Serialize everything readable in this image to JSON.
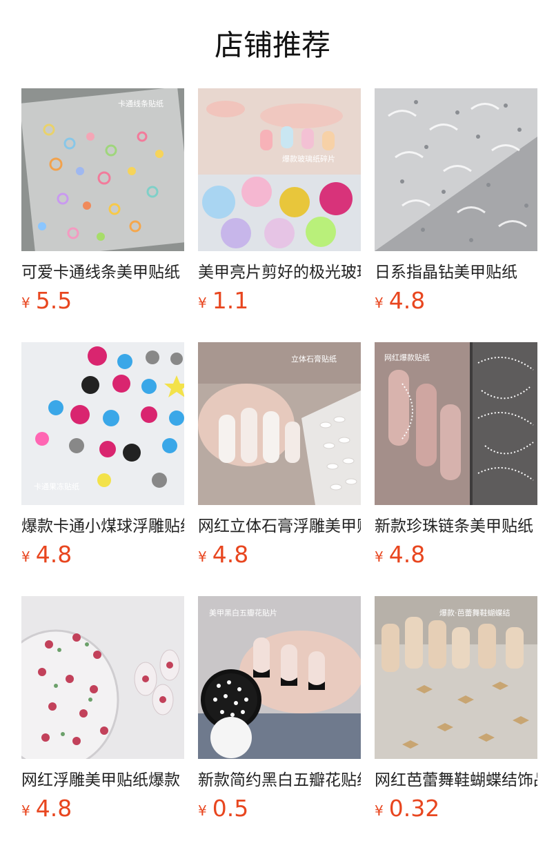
{
  "page": {
    "title": "店铺推荐"
  },
  "products": [
    {
      "name": "可爱卡通线条美甲贴纸",
      "currency": "¥",
      "price": "5.5",
      "image_label": "卡通线条贴纸",
      "image_icon": "cartoon-line-sticker-image"
    },
    {
      "name": "美甲亮片剪好的极光玻璃纸",
      "currency": "¥",
      "price": "1.1",
      "image_label": "爆款玻璃纸碎片",
      "image_icon": "glass-paper-flakes-image"
    },
    {
      "name": "日系指晶钻美甲贴纸",
      "currency": "¥",
      "price": "4.8",
      "image_label": "",
      "image_icon": "pearl-sticker-sheet-image"
    },
    {
      "name": "爆款卡通小煤球浮雕贴纸",
      "currency": "¥",
      "price": "4.8",
      "image_label": "卡通果冻贴纸",
      "image_icon": "soot-sprite-sticker-image"
    },
    {
      "name": "网红立体石膏浮雕美甲贴纸",
      "currency": "¥",
      "price": "4.8",
      "image_label": "立体石膏贴纸",
      "image_icon": "plaster-relief-nails-image"
    },
    {
      "name": "新款珍珠链条美甲贴纸",
      "currency": "¥",
      "price": "4.8",
      "image_label": "网红爆款贴纸",
      "image_icon": "pearl-chain-nails-image"
    },
    {
      "name": "网红浮雕美甲贴纸爆款",
      "currency": "¥",
      "price": "4.8",
      "image_label": "",
      "image_icon": "rose-relief-sticker-image"
    },
    {
      "name": "新款简约黑白五瓣花贴纸",
      "currency": "¥",
      "price": "0.5",
      "image_label": "美甲黑白五瓣花贴片",
      "image_icon": "black-white-flower-nails-image"
    },
    {
      "name": "网红芭蕾舞鞋蝴蝶结饰品",
      "currency": "¥",
      "price": "0.32",
      "image_label": "爆款·芭蕾舞鞋蝴蝶结",
      "image_icon": "ballet-bow-charms-image"
    }
  ],
  "colors": {
    "price": "#e8461f",
    "title": "#111111",
    "name": "#222222"
  }
}
